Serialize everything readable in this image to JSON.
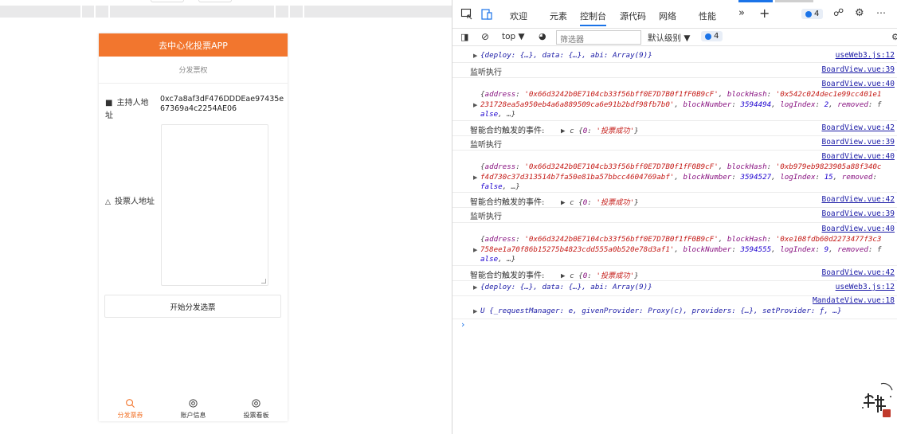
{
  "preview": {
    "header_title": "去中心化投票APP",
    "sub_title": "分发票权",
    "host_label": "主持人地址",
    "host_address": "0xc7a8af3dF476DDDEae97435e67369a4c2254AE06",
    "voter_label": "投票人地址",
    "textarea_value": "",
    "start_button": "开始分发选票",
    "tabs": [
      {
        "label": "分发票券",
        "icon": "search-icon",
        "active": true
      },
      {
        "label": "账户信息",
        "icon": "gear-icon",
        "active": false
      },
      {
        "label": "投票看板",
        "icon": "gear-icon",
        "active": false
      }
    ],
    "accent_color": "#f2762e"
  },
  "devtools": {
    "tabs": [
      "欢迎",
      "元素",
      "控制台",
      "源代码",
      "网络",
      "性能"
    ],
    "active_tab": "控制台",
    "issues_badge": "4",
    "context": "top",
    "filter_placeholder": "筛选器",
    "level": "默认级别",
    "level_badge": "4",
    "console": [
      {
        "type": "obj",
        "text": "{deploy: {…}, data: {…}, abi: Array(9)}",
        "src": "useWeb3.js:12"
      },
      {
        "type": "log",
        "text": "监听执行",
        "src": "BoardView.vue:39"
      },
      {
        "type": "event",
        "src": "BoardView.vue:40",
        "address": "'0x66d3242b0E7104cb33f56bff0E7D7B0f1fF0B9cF'",
        "block_hash": "'0x542c024dec1e99cc401e1231728ea5a950eb4a6a889509ca6e91b2bdf98fb7b0'",
        "block_number": "3594494",
        "log_index": "2",
        "removed": "false"
      },
      {
        "type": "success",
        "text": "智能合约触发的事件:",
        "detail": "c {0: '投票成功'}",
        "src": "BoardView.vue:42"
      },
      {
        "type": "log",
        "text": "监听执行",
        "src": "BoardView.vue:39"
      },
      {
        "type": "event",
        "src": "BoardView.vue:40",
        "address": "'0x66d3242b0E7104cb33f56bff0E7D7B0f1fF0B9cF'",
        "block_hash": "'0xb979eb9823905a88f340cf4d730c37d313514b7fa50e81ba57bbcc4604769abf'",
        "block_number": "3594527",
        "log_index": "15",
        "removed": "false"
      },
      {
        "type": "success",
        "text": "智能合约触发的事件:",
        "detail": "c {0: '投票成功'}",
        "src": "BoardView.vue:42"
      },
      {
        "type": "log",
        "text": "监听执行",
        "src": "BoardView.vue:39"
      },
      {
        "type": "event",
        "src": "BoardView.vue:40",
        "address": "'0x66d3242b0E7104cb33f56bff0E7D7B0f1fF0B9cF'",
        "block_hash": "'0xe108fdb60d2273477f3c3758ee1a70f86b15275b4823cdd555a0b520e78d3af1'",
        "block_number": "3594555",
        "log_index": "9",
        "removed": "false"
      },
      {
        "type": "success",
        "text": "智能合约触发的事件:",
        "detail": "c {0: '投票成功'}",
        "src": "BoardView.vue:42"
      },
      {
        "type": "obj",
        "text": "{deploy: {…}, data: {…}, abi: Array(9)}",
        "src": "useWeb3.js:12"
      },
      {
        "type": "obj2",
        "text": "U {_requestManager: e, givenProvider: Proxy(c), providers: {…}, setProvider: ƒ, …}",
        "src": "MandateView.vue:18"
      }
    ]
  }
}
